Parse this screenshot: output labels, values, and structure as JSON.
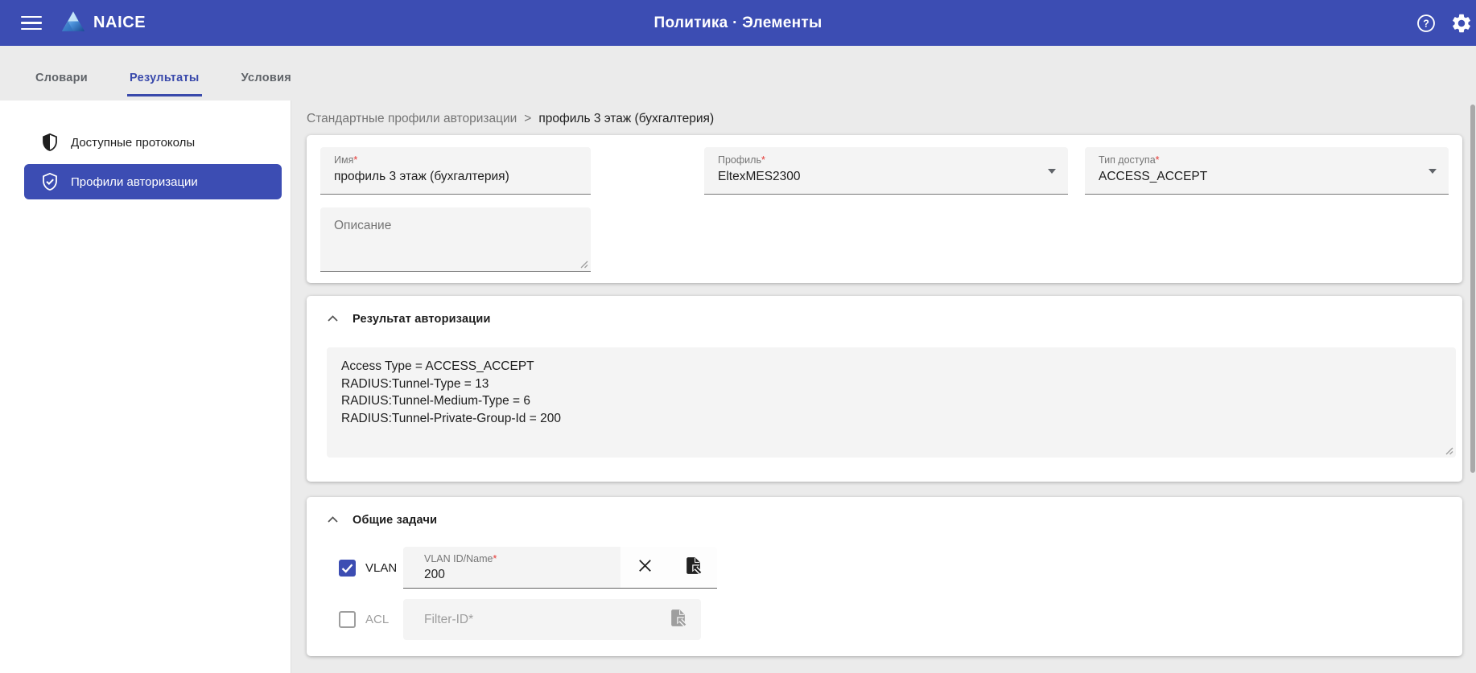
{
  "ui": {
    "required_mark": "*"
  },
  "colors": {
    "header_bg": "#3c4db3",
    "accent": "#3949ab",
    "page_bg": "#ebebeb",
    "asterisk_red": "#e53935",
    "field_bg": "#f4f4f4"
  },
  "header": {
    "app_name": "NAICE",
    "title": "Политика · Элементы"
  },
  "tabs": [
    {
      "label": "Словари",
      "active": false
    },
    {
      "label": "Результаты",
      "active": true
    },
    {
      "label": "Условия",
      "active": false
    }
  ],
  "sidebar": {
    "items": [
      {
        "label": "Доступные протоколы",
        "icon": "shield-half-icon",
        "selected": false
      },
      {
        "label": "Профили авторизации",
        "icon": "shield-check-icon",
        "selected": true
      }
    ]
  },
  "breadcrumb": {
    "parent": "Стандартные профили авторизации",
    "separator": ">",
    "current": "профиль 3 этаж (бухгалтерия)"
  },
  "form": {
    "name": {
      "label": "Имя",
      "required": true,
      "value": "профиль 3 этаж (бухгалтерия)"
    },
    "profile": {
      "label": "Профиль",
      "required": true,
      "value": "EltexMES2300"
    },
    "access_type": {
      "label": "Тип доступа",
      "required": true,
      "value": "ACCESS_ACCEPT"
    },
    "description": {
      "placeholder": "Описание",
      "value": ""
    }
  },
  "auth_result": {
    "section_title": "Результат авторизации",
    "value": "Access Type = ACCESS_ACCEPT\nRADIUS:Tunnel-Type = 13\nRADIUS:Tunnel-Medium-Type = 6\nRADIUS:Tunnel-Private-Group-Id = 200"
  },
  "tasks": {
    "section_title": "Общие задачи",
    "vlan": {
      "label": "VLAN",
      "checked": true,
      "field_label": "VLAN ID/Name",
      "required": true,
      "value": "200"
    },
    "acl": {
      "label": "ACL",
      "checked": false,
      "placeholder": "Filter-ID*",
      "value": ""
    }
  }
}
